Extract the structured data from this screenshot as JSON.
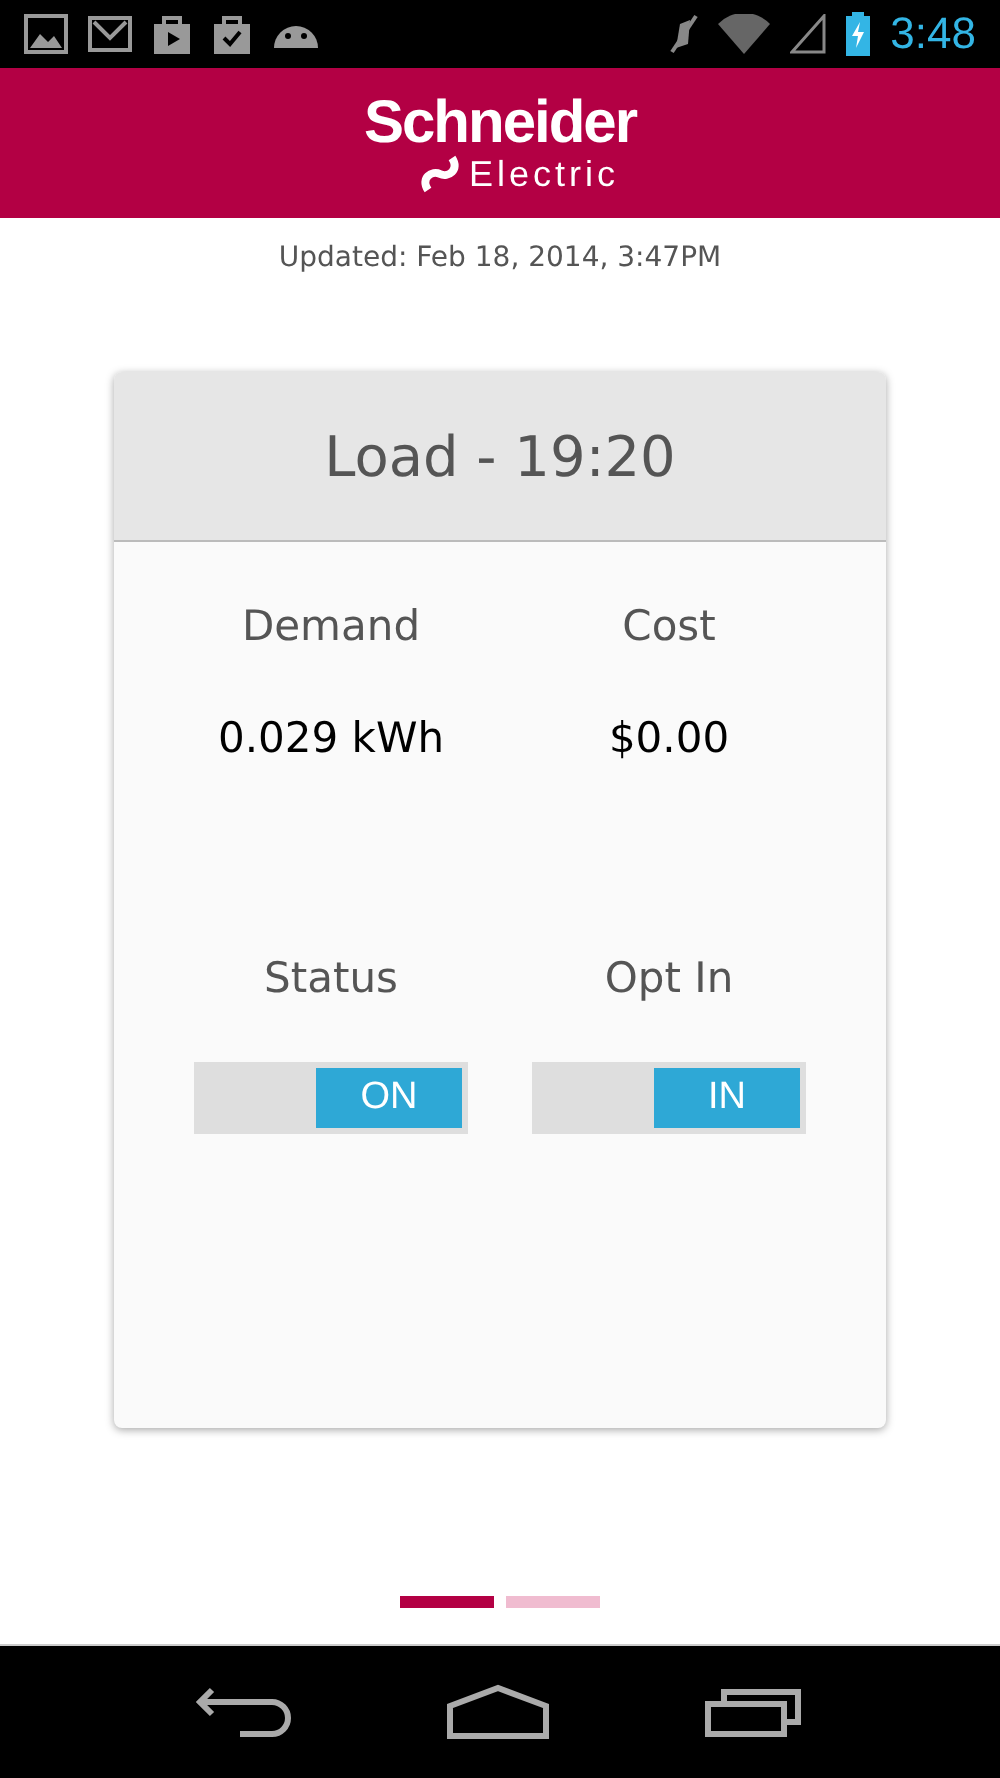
{
  "status_bar": {
    "time": "3:48"
  },
  "header": {
    "brand": "Schneider",
    "brand_sub": "Electric"
  },
  "updated": "Updated: Feb 18, 2014, 3:47PM",
  "card": {
    "title": "Load - 19:20",
    "metrics": [
      {
        "label": "Demand",
        "value": "0.029 kWh"
      },
      {
        "label": "Cost",
        "value": "$0.00"
      }
    ],
    "toggles": [
      {
        "label": "Status",
        "text": "ON",
        "on": true
      },
      {
        "label": "Opt In",
        "text": "IN",
        "on": true
      }
    ]
  },
  "pages": [
    {
      "selected": true
    },
    {
      "selected": false
    }
  ]
}
